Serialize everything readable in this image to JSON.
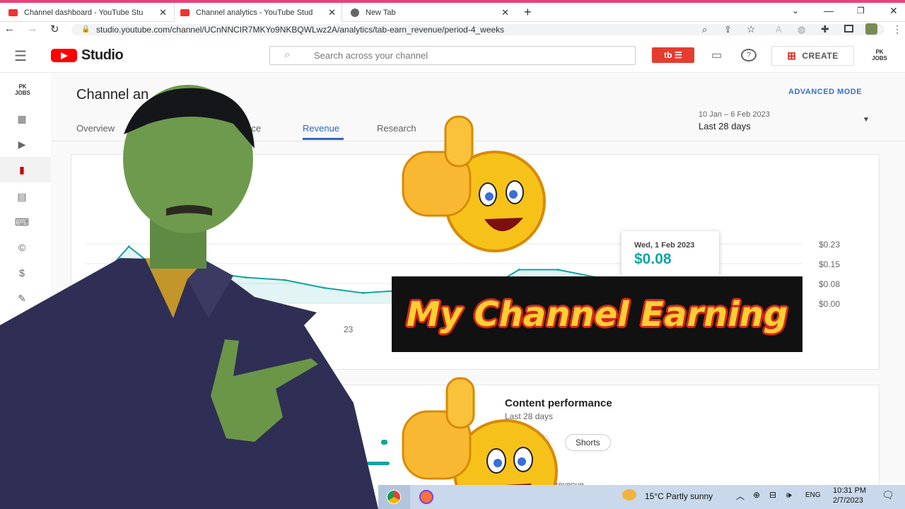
{
  "browser": {
    "tabs": [
      {
        "title": "Channel dashboard - YouTube Stu",
        "close": "✕"
      },
      {
        "title": "Channel analytics - YouTube Stud",
        "close": "✕"
      },
      {
        "title": "New Tab",
        "close": "✕"
      }
    ],
    "new_tab": "+",
    "url": "studio.youtube.com/channel/UCnNNCIR7MKYo9NKBQWLwz2A/analytics/tab-earn_revenue/period-4_weeks"
  },
  "header": {
    "logo_text": "Studio",
    "search_placeholder": "Search across your channel",
    "create_label": "CREATE",
    "channel_badge": "PK JOBS"
  },
  "sidebar": {
    "channel_badge": "PK JOBS"
  },
  "analytics": {
    "title": "Channel an",
    "advanced_mode": "ADVANCED MODE",
    "tabs": [
      "Overview",
      "ience",
      "Revenue",
      "Research"
    ],
    "active_tab": "Revenue",
    "date_range": "10 Jan – 6 Feb 2023",
    "period": "Last 28 days"
  },
  "chart_data": {
    "type": "line",
    "yticks": [
      "$0.23",
      "$0.15",
      "$0.08",
      "$0.00"
    ],
    "ylim": [
      0,
      0.23
    ],
    "x_partial_label": "23",
    "series": [
      {
        "values": [
          0.05,
          0.22,
          0.1,
          0.12,
          0.1,
          0.09,
          0.06,
          0.04,
          0.05,
          0.03,
          0.04,
          0.13,
          0.13,
          0.1,
          0.08,
          0.1,
          0.14
        ]
      }
    ],
    "tooltip": {
      "date": "Wed, 1 Feb 2023",
      "value": "$0.08"
    },
    "color": "#12a4a0"
  },
  "content_performance": {
    "title": "Content performance",
    "subtitle": "Last 28 days",
    "chips": [
      "s",
      "Shorts"
    ],
    "partial_text": "revenue"
  },
  "overlay": {
    "headline": "My Channel Earning"
  },
  "taskbar": {
    "weather": "15°C  Partly sunny",
    "lang": "ENG",
    "time": "10:31 PM",
    "date": "2/7/2023"
  }
}
